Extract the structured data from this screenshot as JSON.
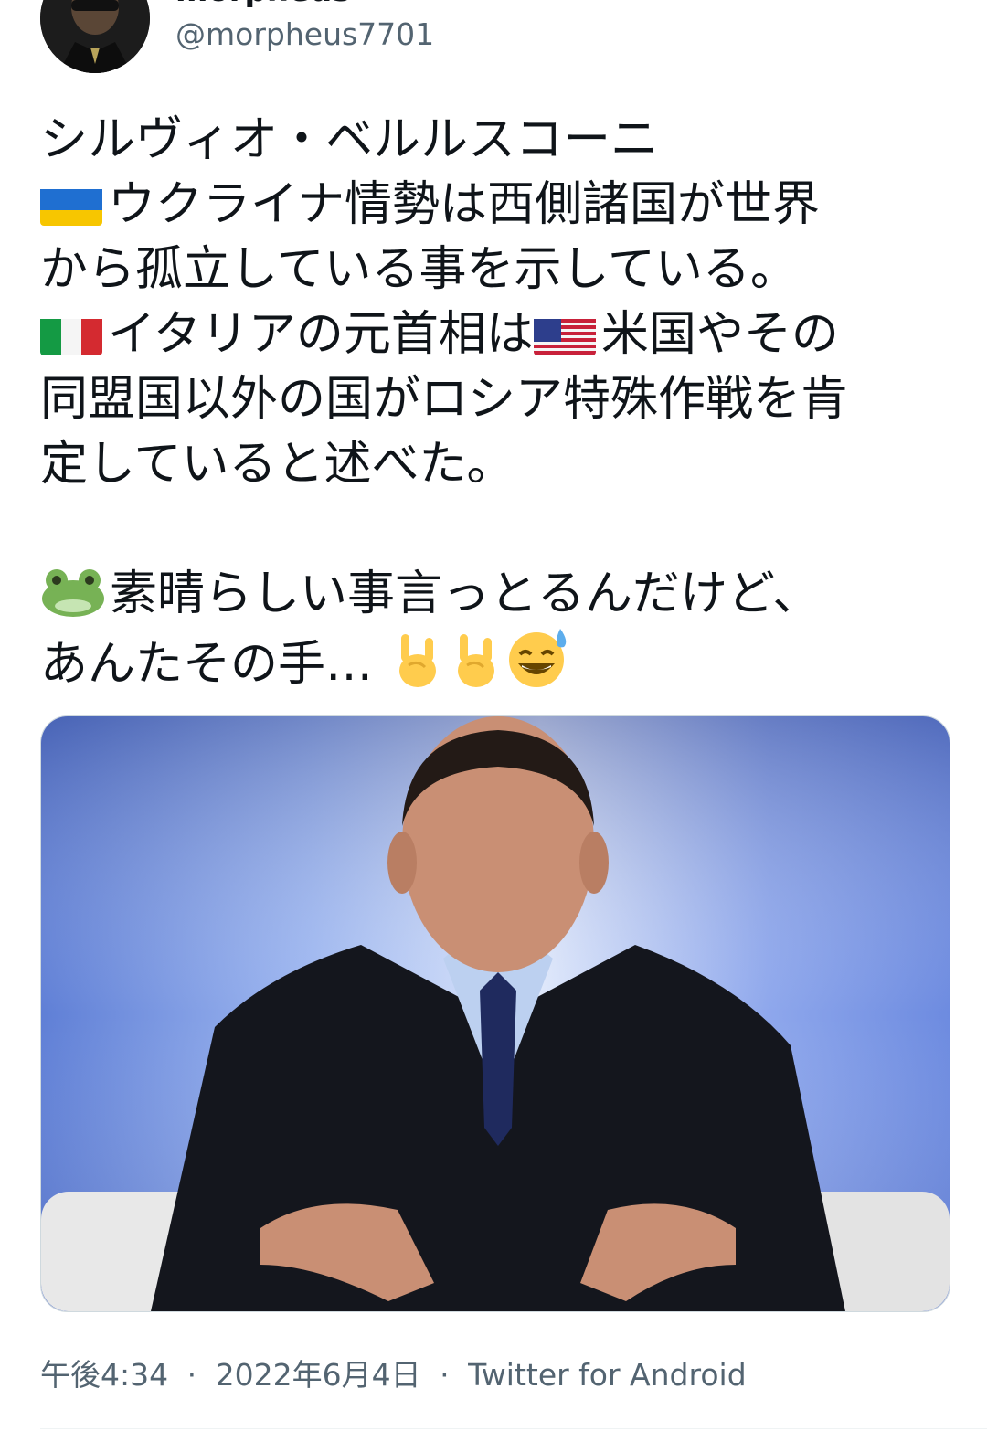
{
  "author": {
    "display_name": "morpheus",
    "handle": "@morpheus7701"
  },
  "tweet": {
    "lines": [
      "シルヴィオ・ベルルスコーニ",
      "ウクライナ情勢は西側諸国が世界",
      "から孤立している事を示している。",
      "イタリアの元首相は",
      "米国やその",
      "同盟国以外の国がロシア特殊作戦を肯",
      "定していると述べた。",
      "素晴らしい事言っとるんだけど、",
      "あんたその手…"
    ],
    "emojis": [
      "ukraine-flag",
      "italy-flag",
      "usa-flag",
      "frog-face",
      "sign-of-horns",
      "sign-of-horns",
      "grinning-sweat-face"
    ]
  },
  "meta": {
    "time": "午後4:34",
    "date": "2022年6月4日",
    "source": "Twitter for Android",
    "separator": "·"
  },
  "colors": {
    "text": "#0f1419",
    "secondary": "#536471",
    "border": "#cfd9de"
  }
}
